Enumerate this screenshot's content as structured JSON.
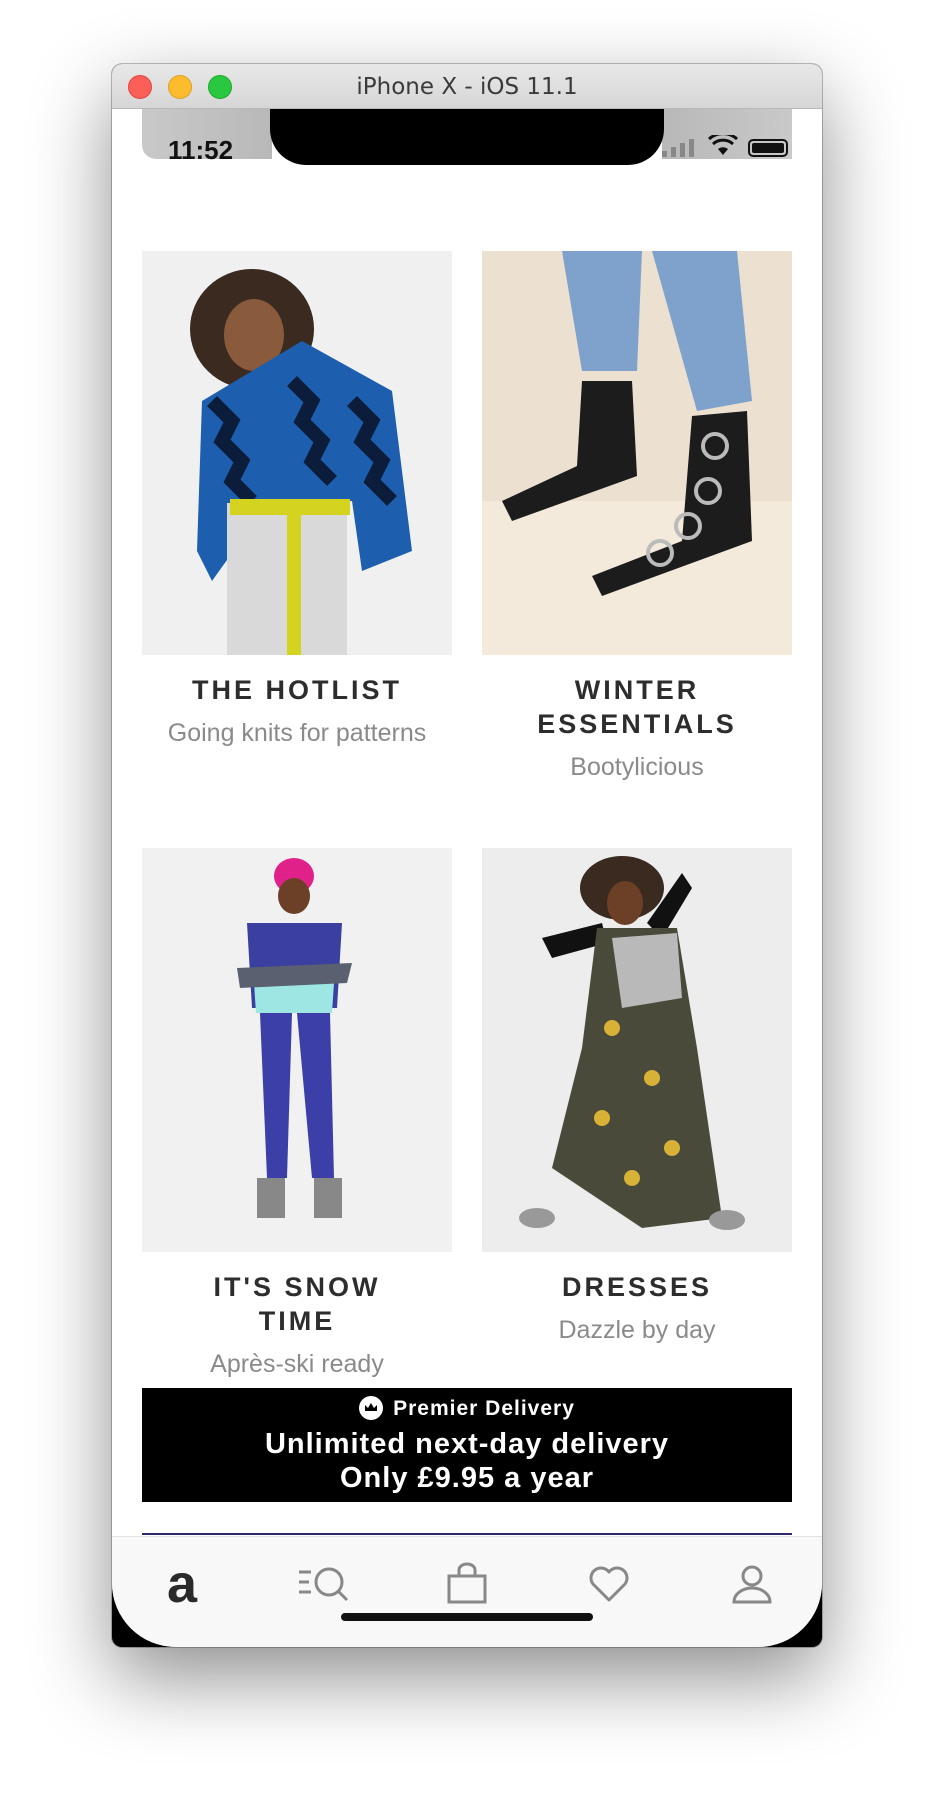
{
  "window": {
    "title": "iPhone X - iOS 11.1"
  },
  "status_bar": {
    "time": "11:52"
  },
  "tiles": [
    {
      "heading": "THE HOTLIST",
      "sub": "Going knits for patterns"
    },
    {
      "heading": "WINTER ESSENTIALS",
      "sub": "Bootylicious"
    },
    {
      "heading": "IT'S SNOW TIME",
      "sub": "Après-ski ready"
    },
    {
      "heading": "DRESSES",
      "sub": "Dazzle by day"
    }
  ],
  "premier": {
    "title": "Premier Delivery",
    "line1": "Unlimited next-day delivery",
    "line2": "Only £9.95 a year"
  },
  "tab_bar": {
    "brand_letter": "a",
    "icons": [
      "home-logo-icon",
      "search-list-icon",
      "bag-icon",
      "heart-icon",
      "account-icon"
    ]
  },
  "colors": {
    "accent": "#2d2a6e",
    "premier_bg": "#000000",
    "text_dark": "#2d2d2d",
    "text_grey": "#8a8a8a"
  }
}
